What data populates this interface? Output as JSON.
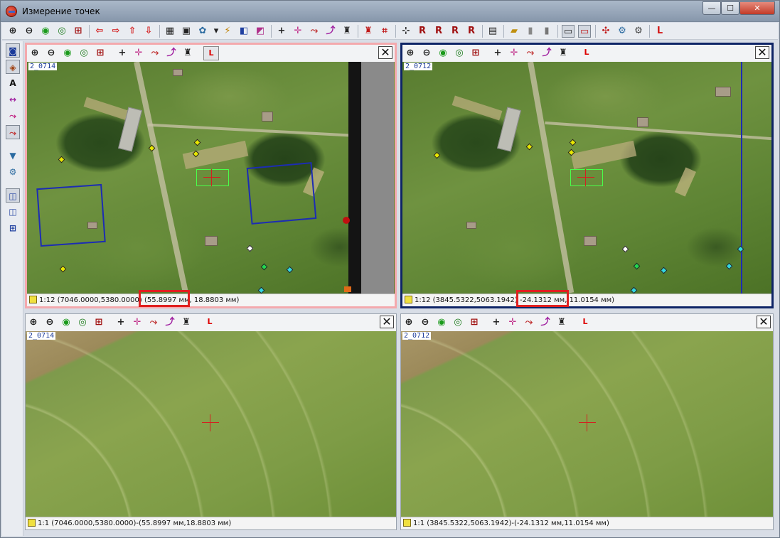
{
  "window": {
    "title": "Измерение точек"
  },
  "controls": {
    "minimize": "—",
    "maximize": "☐",
    "close": "✕"
  },
  "colors": {
    "accent_red": "#e01f1f",
    "active_border": "#0e2466",
    "secondary_border": "#f4a9ad"
  },
  "main_toolbar": [
    {
      "icon": "zoom-in-icon",
      "glyph": "⊕",
      "color": "#1a1a1a"
    },
    {
      "icon": "zoom-out-icon",
      "glyph": "⊖",
      "color": "#1a1a1a"
    },
    {
      "icon": "zoom-fit-icon",
      "glyph": "◉",
      "color": "#1a9a1a"
    },
    {
      "icon": "zoom-window-icon",
      "glyph": "◎",
      "color": "#1a7a1a"
    },
    {
      "icon": "grid-icon",
      "glyph": "⊞",
      "color": "#a01010"
    },
    {
      "icon": "arrow-left-icon",
      "glyph": "⇦",
      "color": "#d41a1a"
    },
    {
      "icon": "arrow-right-icon",
      "glyph": "⇨",
      "color": "#d41a1a"
    },
    {
      "icon": "arrow-up-icon",
      "glyph": "⇧",
      "color": "#d41a1a"
    },
    {
      "icon": "arrow-down-icon",
      "glyph": "⇩",
      "color": "#d41a1a"
    },
    {
      "icon": "layout-icon",
      "glyph": "▦",
      "color": "#222"
    },
    {
      "icon": "add-image-icon",
      "glyph": "▣",
      "color": "#222"
    },
    {
      "icon": "settings-dropdown-icon",
      "glyph": "✿",
      "color": "#2a6aa0"
    },
    {
      "icon": "dropdown-arrow-icon",
      "glyph": "▾",
      "color": "#222"
    },
    {
      "icon": "lightning-icon",
      "glyph": "⚡",
      "color": "#c08000"
    },
    {
      "icon": "stereo-icon",
      "glyph": "◧",
      "color": "#2040a0"
    },
    {
      "icon": "color-icon",
      "glyph": "◩",
      "color": "#b0308a"
    },
    {
      "icon": "add-point-icon",
      "glyph": "+",
      "color": "#222"
    },
    {
      "icon": "add-point-snap-icon",
      "glyph": "✛",
      "color": "#c0308a"
    },
    {
      "icon": "move-point-icon",
      "glyph": "⤳",
      "color": "#c03030"
    },
    {
      "icon": "edit-point-icon",
      "glyph": "⤴",
      "color": "#a020a0"
    },
    {
      "icon": "delete-point-icon",
      "glyph": "♜",
      "color": "#222"
    },
    {
      "icon": "delete-all-icon",
      "glyph": "♜",
      "color": "#c01818"
    },
    {
      "icon": "tie-points-icon",
      "glyph": "⌗",
      "color": "#c01818"
    },
    {
      "icon": "measure-icon",
      "glyph": "⊹",
      "color": "#222"
    },
    {
      "icon": "residual-r-icon",
      "glyph": "R",
      "color": "#a01010"
    },
    {
      "icon": "residual-r-icon",
      "glyph": "R",
      "color": "#a01010"
    },
    {
      "icon": "r-icon",
      "glyph": "R",
      "color": "#a01010"
    },
    {
      "icon": "r-query-icon",
      "glyph": "R",
      "color": "#a01010"
    },
    {
      "icon": "document-icon",
      "glyph": "▤",
      "color": "#222"
    },
    {
      "icon": "export-icon",
      "glyph": "▰",
      "color": "#c09010"
    },
    {
      "icon": "copy-icon",
      "glyph": "▮",
      "color": "#888"
    },
    {
      "icon": "paste-icon",
      "glyph": "▮",
      "color": "#777"
    },
    {
      "icon": "single-view-icon",
      "glyph": "▭",
      "color": "#222"
    },
    {
      "icon": "dual-view-icon",
      "glyph": "▭",
      "color": "#c01818"
    },
    {
      "icon": "add-settings-icon",
      "glyph": "✣",
      "color": "#c01818"
    },
    {
      "icon": "gears-icon",
      "glyph": "⚙",
      "color": "#2a6aa0"
    },
    {
      "icon": "gear-list-icon",
      "glyph": "⚙",
      "color": "#444"
    },
    {
      "icon": "l-icon",
      "glyph": "L",
      "color": "#d41a1a"
    }
  ],
  "sidebar": [
    {
      "icon": "camera-icon",
      "glyph": "◙",
      "pressed": true
    },
    {
      "icon": "images-icon",
      "glyph": "◈",
      "pressed": true
    },
    {
      "icon": "text-icon",
      "glyph": "A",
      "pressed": false
    },
    {
      "icon": "link-icon",
      "glyph": "↔",
      "pressed": false
    },
    {
      "icon": "point-edit-icon",
      "glyph": "⤳",
      "pressed": false
    },
    {
      "icon": "point-move-icon",
      "glyph": "⤳",
      "pressed": true
    },
    {
      "icon": "filter-icon",
      "glyph": "▼",
      "pressed": false
    },
    {
      "icon": "settings-icon",
      "glyph": "⚙",
      "pressed": false
    },
    {
      "icon": "window-icon",
      "glyph": "◫",
      "pressed": true
    },
    {
      "icon": "window-stack-icon",
      "glyph": "◫",
      "pressed": false
    },
    {
      "icon": "tiles-icon",
      "glyph": "⊞",
      "pressed": false
    }
  ],
  "panel_toolbar": [
    {
      "icon": "zoom-in-icon",
      "glyph": "⊕",
      "color": "#1a1a1a"
    },
    {
      "icon": "zoom-out-icon",
      "glyph": "⊖",
      "color": "#1a1a1a"
    },
    {
      "icon": "zoom-fit-icon",
      "glyph": "◉",
      "color": "#1a9a1a"
    },
    {
      "icon": "zoom-window-icon",
      "glyph": "◎",
      "color": "#1a7a1a"
    },
    {
      "icon": "grid-icon",
      "glyph": "⊞",
      "color": "#a01010"
    },
    {
      "icon": "add-point-icon",
      "glyph": "+",
      "color": "#222"
    },
    {
      "icon": "add-point-snap-icon",
      "glyph": "✛",
      "color": "#c0308a"
    },
    {
      "icon": "move-point-icon",
      "glyph": "⤳",
      "color": "#c03030"
    },
    {
      "icon": "edit-point-icon",
      "glyph": "⤴",
      "color": "#a020a0"
    },
    {
      "icon": "delete-point-icon",
      "glyph": "♜",
      "color": "#222"
    }
  ],
  "panel_l_label": "L",
  "panel_close": "✕",
  "panels": {
    "top_left": {
      "image": "2_0714",
      "status_prefix": "1:12 (7046.0000,5380.0000)",
      "status_highlight": "(55.8997 мм,",
      "status_suffix": "18.8803 мм)"
    },
    "top_right": {
      "image": "2_0712",
      "status_prefix": "1:12 (3845.5322,5063.1942)",
      "status_highlight": "-24.1312 мм,",
      "status_suffix": "11.0154 мм)"
    },
    "bottom_left": {
      "image": "2_0714",
      "status_text": "1:1 (7046.0000,5380.0000)-(55.8997 мм,18.8803 мм)"
    },
    "bottom_right": {
      "image": "2_0712",
      "status_text": "1:1 (3845.5322,5063.1942)-(-24.1312 мм,11.0154 мм)"
    }
  }
}
